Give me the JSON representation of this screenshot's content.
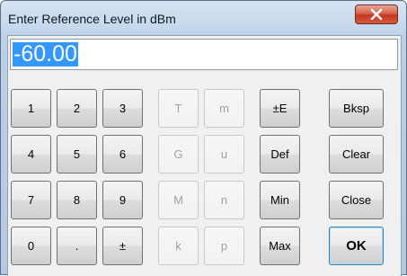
{
  "window": {
    "title": "Enter Reference Level in dBm",
    "close_glyph": "x"
  },
  "entry": {
    "value": "-60.00"
  },
  "keypad": {
    "digits": [
      "1",
      "2",
      "3",
      "4",
      "5",
      "6",
      "7",
      "8",
      "9",
      "0",
      ".",
      "±"
    ],
    "prefixes": [
      "T",
      "m",
      "G",
      "u",
      "M",
      "n",
      "k",
      "p"
    ],
    "functions": {
      "exp": "±E",
      "def": "Def",
      "min": "Min",
      "max": "Max",
      "bksp": "Bksp",
      "clear": "Clear",
      "close": "Close",
      "ok": "OK"
    }
  },
  "colors": {
    "selection": "#3399ff",
    "close_button": "#c8472c",
    "disabled_text": "#a0a0a0"
  }
}
